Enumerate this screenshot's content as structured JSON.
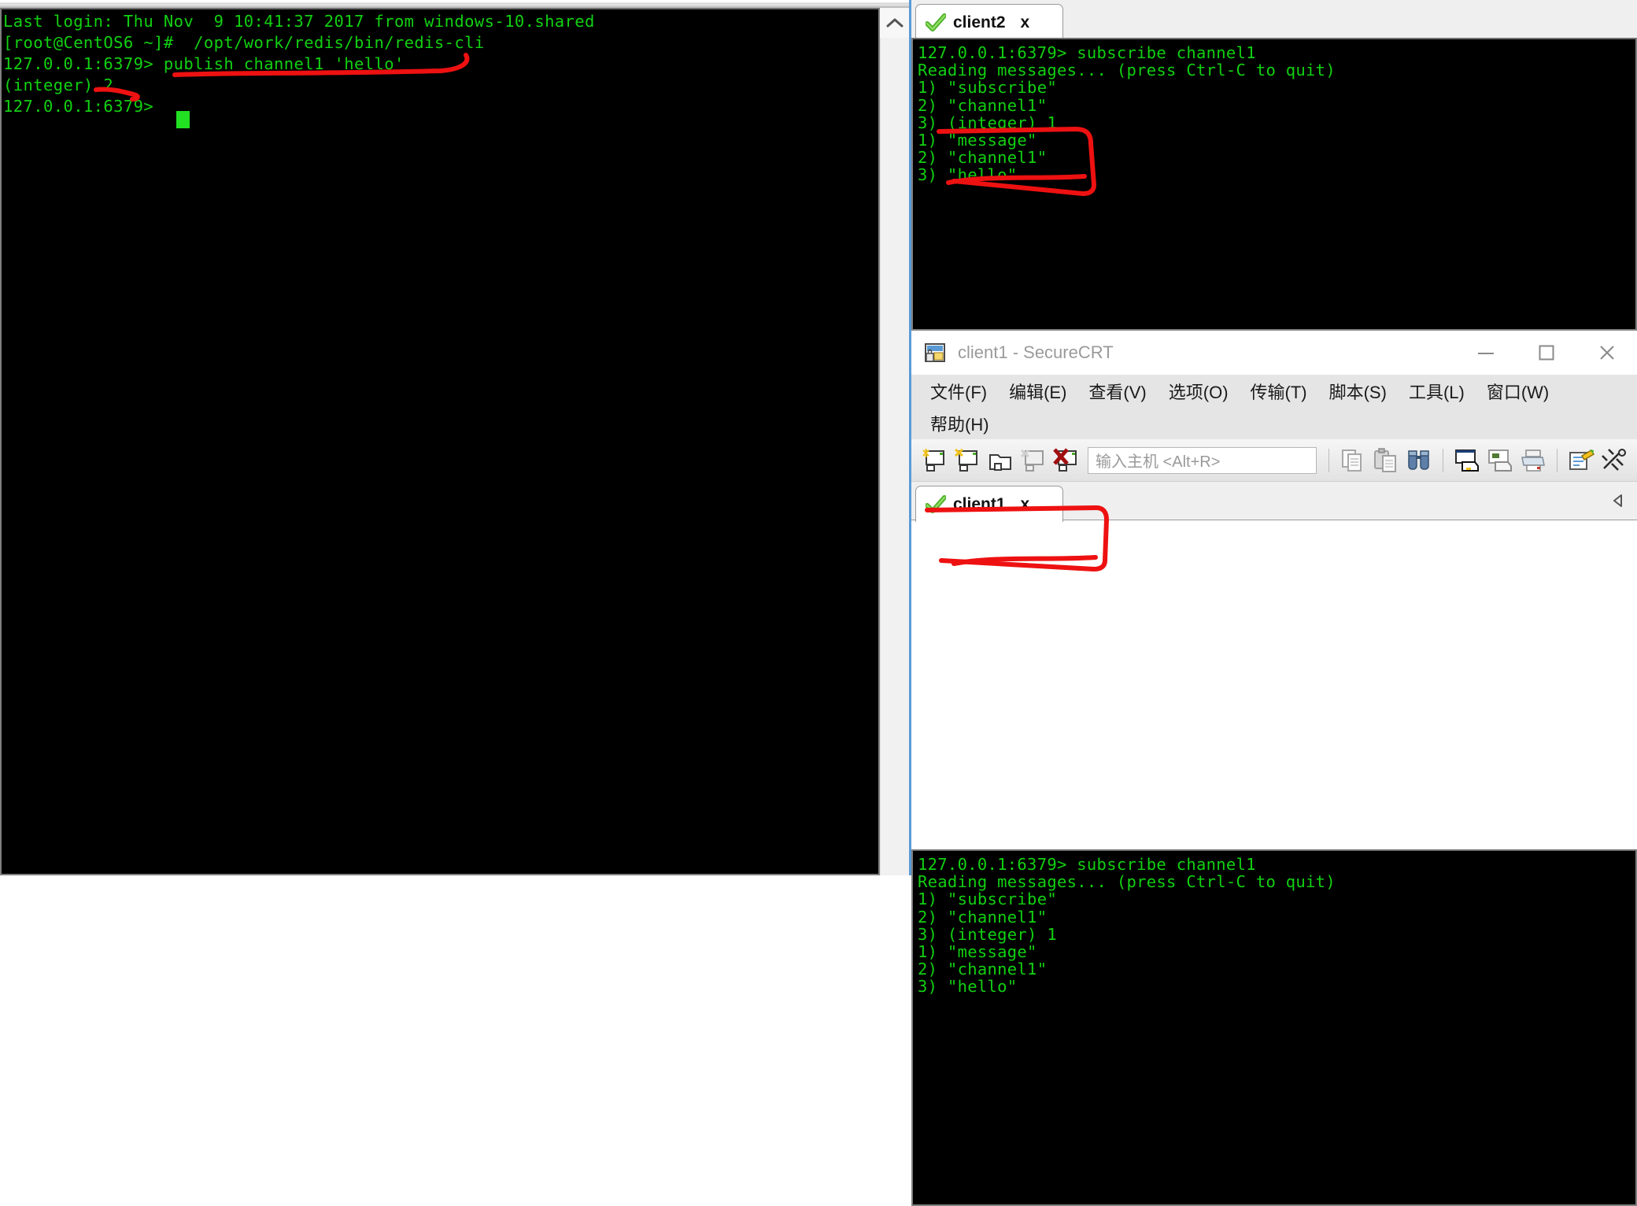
{
  "left_terminal": {
    "name": "root-shell",
    "lines": [
      "Last login: Thu Nov  9 10:41:37 2017 from windows-10.shared",
      "[root@CentOS6 ~]#  /opt/work/redis/bin/redis-cli",
      "127.0.0.1:6379> publish channel1 'hello'",
      "(integer) 2",
      "127.0.0.1:6379>"
    ],
    "text": "Last login: Thu Nov  9 10:41:37 2017 from windows-10.shared\n[root@CentOS6 ~]#  /opt/work/redis/bin/redis-cli\n127.0.0.1:6379> publish channel1 'hello'\n(integer) 2\n127.0.0.1:6379>",
    "scrollbar": {
      "up_arrow": "chevron-up-icon"
    }
  },
  "client2_window": {
    "tab": {
      "label": "client2",
      "close_label": "x",
      "status_icon": "green-check-icon"
    },
    "terminal": {
      "lines": [
        "127.0.0.1:6379> subscribe channel1",
        "Reading messages... (press Ctrl-C to quit)",
        "1) \"subscribe\"",
        "2) \"channel1\"",
        "3) (integer) 1",
        "1) \"message\"",
        "2) \"channel1\"",
        "3) \"hello\""
      ],
      "text": "127.0.0.1:6379> subscribe channel1\nReading messages... (press Ctrl-C to quit)\n1) \"subscribe\"\n2) \"channel1\"\n3) (integer) 1\n1) \"message\"\n2) \"channel1\"\n3) \"hello\""
    }
  },
  "client1_window": {
    "title": "client1 - SecureCRT",
    "app_icon": "securecrt-icon",
    "window_controls": {
      "minimize": "minimize-icon",
      "maximize": "maximize-icon",
      "close": "close-icon"
    },
    "menu": [
      {
        "label": "文件(F)"
      },
      {
        "label": "编辑(E)"
      },
      {
        "label": "查看(V)"
      },
      {
        "label": "选项(O)"
      },
      {
        "label": "传输(T)"
      },
      {
        "label": "脚本(S)"
      },
      {
        "label": "工具(L)"
      },
      {
        "label": "窗口(W)"
      },
      {
        "label": "帮助(H)"
      }
    ],
    "toolbar": {
      "left_icons": [
        "new-session-icon",
        "quick-connect-icon",
        "new-tab-icon",
        "reconnect-icon",
        "disconnect-icon"
      ],
      "host_placeholder": "输入主机 <Alt+R>",
      "right_icons": [
        "copy-icon",
        "paste-icon",
        "find-icon",
        "print-screen-icon",
        "log-session-icon",
        "print-icon",
        "session-options-icon",
        "settings-icon"
      ]
    },
    "tab": {
      "label": "client1",
      "close_label": "x",
      "status_icon": "green-check-icon"
    },
    "tab_scroll_left": "triangle-left-icon",
    "terminal": {
      "lines": [
        "127.0.0.1:6379> subscribe channel1",
        "Reading messages... (press Ctrl-C to quit)",
        "1) \"subscribe\"",
        "2) \"channel1\"",
        "3) (integer) 1",
        "1) \"message\"",
        "2) \"channel1\"",
        "3) \"hello\""
      ],
      "text": "127.0.0.1:6379> subscribe channel1\nReading messages... (press Ctrl-C to quit)\n1) \"subscribe\"\n2) \"channel1\"\n3) (integer) 1\n1) \"message\"\n2) \"channel1\"\n3) \"hello\""
    }
  },
  "annotations": {
    "color": "#ee1111",
    "items": [
      {
        "name": "underline-publish-command",
        "target": "publish channel1 'hello'"
      },
      {
        "name": "underline-integer-2",
        "target": "(integer) 2"
      },
      {
        "name": "bracket-client2-message",
        "target": "1) \"message\" 2) \"channel1\" 3) \"hello\""
      },
      {
        "name": "bracket-client1-message",
        "target": "1) \"message\" 2) \"channel1\" 3) \"hello\""
      }
    ]
  },
  "colors": {
    "terminal_bg": "#000000",
    "terminal_fg": "#12d012",
    "annotation_red": "#ee1111",
    "accent_blue": "#5b9bd5"
  }
}
